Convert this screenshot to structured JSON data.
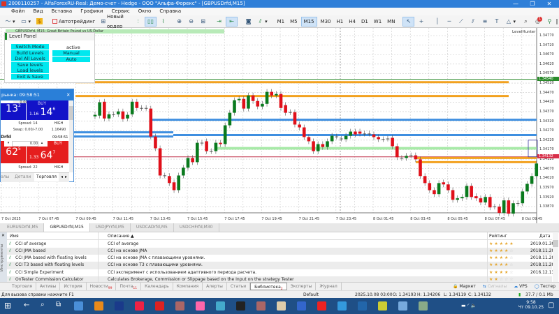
{
  "window": {
    "title": "2000110257 - AlfaForexRU-Real: Демо-счет - Hedge - ООО \"Альфа-Форекс\" - [GBPUSDrfd,M15]",
    "minimize": "—",
    "maximize": "❐",
    "close": "✕"
  },
  "menu": [
    "Файл",
    "Вид",
    "Вставка",
    "Графики",
    "Сервис",
    "Окно",
    "Справка"
  ],
  "toolbar": {
    "algo_trading": "Автотрейдинг",
    "new_order": "Новый ордер",
    "timeframes": [
      "M1",
      "M5",
      "M15",
      "M30",
      "H1",
      "H4",
      "D1",
      "W1",
      "MN"
    ],
    "active_timeframe": "M15",
    "notification_count": "1"
  },
  "chart": {
    "header": "GBPUSDrfd, M15:  Great Britain Pound vs US Dollar",
    "indicator_name": "LevelHunter",
    "colors": {
      "bull": "#0a7a1e",
      "bear": "#e0101a",
      "orange": "#f2a11e",
      "blue": "#3f8fe0",
      "green_band": "#9ee89e",
      "red_line": "#c0304a"
    }
  },
  "chart_data": {
    "type": "candlestick",
    "ylim": [
      1.3383,
      1.348
    ],
    "price_ticks": [
      "1.34770",
      "1.34720",
      "1.34670",
      "1.34620",
      "1.34570",
      "1.34520",
      "1.34470",
      "1.34420",
      "1.34370",
      "1.34320",
      "1.34270",
      "1.34220",
      "1.34170",
      "1.34120",
      "1.34070",
      "1.34020",
      "1.33970",
      "1.33920",
      "1.33870"
    ],
    "time_ticks": [
      "7 Oct 2025",
      "7 Oct 07:45",
      "7 Oct 09:45",
      "7 Oct 11:45",
      "7 Oct 13:45",
      "7 Oct 15:45",
      "7 Oct 17:45",
      "7 Oct 19:45",
      "7 Oct 21:45",
      "7 Oct 23:45",
      "8 Oct 01:45",
      "8 Oct 03:45",
      "8 Oct 05:45",
      "8 Oct 07:45",
      "8 Oct 09:45"
    ],
    "candles_open_close": [
      [
        1.34345,
        1.34353
      ],
      [
        1.34349,
        1.34419
      ],
      [
        1.34422,
        1.34334
      ],
      [
        1.34334,
        1.34356
      ],
      [
        1.34356,
        1.34356
      ],
      [
        1.34356,
        1.34371
      ],
      [
        1.34371,
        1.34331
      ],
      [
        1.34334,
        1.34353
      ],
      [
        1.34356,
        1.34422
      ],
      [
        1.34422,
        1.34389
      ],
      [
        1.34389,
        1.34389
      ],
      [
        1.34389,
        1.34389
      ],
      [
        1.34386,
        1.34239
      ],
      [
        1.34239,
        1.34177
      ],
      [
        1.34177,
        1.34034
      ],
      [
        1.34034,
        1.34034
      ],
      [
        1.34031,
        1.33994
      ],
      [
        1.33998,
        1.33957
      ],
      [
        1.33957,
        1.34034
      ],
      [
        1.34034,
        1.34075
      ],
      [
        1.34075,
        1.34126
      ],
      [
        1.34126,
        1.34104
      ],
      [
        1.34104,
        1.34206
      ],
      [
        1.34206,
        1.34206
      ],
      [
        1.34214,
        1.34162
      ],
      [
        1.34162,
        1.34162
      ],
      [
        1.34162,
        1.34206
      ],
      [
        1.34206,
        1.34199
      ],
      [
        1.34199,
        1.34298
      ],
      [
        1.34298,
        1.34364
      ],
      [
        1.34364,
        1.3443
      ],
      [
        1.3443,
        1.34437
      ],
      [
        1.34437,
        1.34386
      ],
      [
        1.34386,
        1.34455
      ],
      [
        1.34455,
        1.34426
      ],
      [
        1.34426,
        1.34397
      ],
      [
        1.34397,
        1.34411
      ],
      [
        1.34411,
        1.34474
      ],
      [
        1.34474,
        1.34455
      ],
      [
        1.34455,
        1.34463
      ],
      [
        1.34463,
        1.34389
      ],
      [
        1.34404,
        1.34364
      ],
      [
        1.34367,
        1.34367
      ],
      [
        1.34367,
        1.34302
      ],
      [
        1.34302,
        1.34287
      ],
      [
        1.34287,
        1.34236
      ],
      [
        1.34236,
        1.34214
      ],
      [
        1.34214,
        1.34162
      ],
      [
        1.34162,
        1.34199
      ],
      [
        1.34199,
        1.34184
      ],
      [
        1.34184,
        1.34214
      ],
      [
        1.34214,
        1.34243
      ],
      [
        1.34239,
        1.34239
      ],
      [
        1.34228,
        1.34228
      ],
      [
        1.34225,
        1.34243
      ],
      [
        1.34243,
        1.34265
      ],
      [
        1.34265,
        1.3425
      ],
      [
        1.34265,
        1.34254
      ],
      [
        1.34254,
        1.34254
      ],
      [
        1.34254,
        1.34254
      ],
      [
        1.3425,
        1.34236
      ],
      [
        1.34236,
        1.34225
      ],
      [
        1.34225,
        1.34225
      ],
      [
        1.34228,
        1.34228
      ],
      [
        1.34232,
        1.34188
      ],
      [
        1.34188,
        1.3413
      ],
      [
        1.34126,
        1.34126
      ],
      [
        1.34126,
        1.34137
      ],
      [
        1.3414,
        1.3414
      ],
      [
        1.3414,
        1.34119
      ],
      [
        1.34119,
        1.34031
      ],
      [
        1.34031,
        1.33994
      ],
      [
        1.33994,
        1.33957
      ],
      [
        1.33957,
        1.33936
      ],
      [
        1.33936,
        1.33994
      ],
      [
        1.33998,
        1.33987
      ],
      [
        1.33987,
        1.33957
      ],
      [
        1.33957,
        1.33906
      ],
      [
        1.33906,
        1.33914
      ],
      [
        1.33914,
        1.33921
      ],
      [
        1.33921,
        1.33979
      ],
      [
        1.33979,
        1.33921
      ],
      [
        1.33925,
        1.33914
      ],
      [
        1.33914,
        1.33892
      ],
      [
        1.33892,
        1.33921
      ],
      [
        1.33921,
        1.33866
      ],
      [
        1.3387,
        1.3387
      ],
      [
        1.3387,
        1.33837
      ],
      [
        1.33837,
        1.33903
      ],
      [
        1.33903,
        1.33833
      ],
      [
        1.33833,
        1.33888
      ],
      [
        1.33888,
        1.33888
      ],
      [
        1.33888,
        1.3395
      ],
      [
        1.3395,
        1.3399
      ],
      [
        1.3399,
        1.34031
      ],
      [
        1.34031,
        1.34097
      ]
    ],
    "levels": [
      {
        "price": 1.3454,
        "color": "green",
        "label": "1.34540"
      },
      {
        "price": 1.34525,
        "color": "orange"
      },
      {
        "price": 1.34452,
        "color": "orange"
      },
      {
        "price": 1.34327,
        "color": "blue"
      },
      {
        "price": 1.34261,
        "color": "blue"
      },
      {
        "price": 1.34247,
        "color": "blue"
      },
      {
        "price": 1.34239,
        "color": "blue"
      },
      {
        "price_from": 1.3417,
        "price_to": 1.34184,
        "color": "green_band"
      },
      {
        "price": 1.34132,
        "color": "red",
        "label": "1.34132"
      },
      {
        "price": 1.34126,
        "color": "orange"
      },
      {
        "price": 1.34104,
        "color": "orange"
      }
    ]
  },
  "level_panel": {
    "title": "Level Panel",
    "buttons": [
      "Switch Mode",
      "Build Levels",
      "Del All Levels",
      "Save levels",
      "Load levels",
      "Exit & Save"
    ],
    "mode_label": "active",
    "modes": [
      "Manual",
      "Auto"
    ]
  },
  "trade_panel": {
    "title": "рынка: 09:58:51",
    "sym1": {
      "lot": "0.00",
      "buy": "BUY",
      "sell_main": "13",
      "sell_sup": "2",
      "sell_prefix": "s",
      "buy_prefix": "1.16",
      "buy_main": "14",
      "buy_sup": "6",
      "spread": "Spread: 14",
      "swap": "Swap: 0.00/-7.00",
      "high_label": "HIGH",
      "high": "1.16490"
    },
    "sym2": {
      "name": "Drfd",
      "time": "09:58:51",
      "lot": "0.00",
      "buy": "BUY",
      "sell_main": "62",
      "sell_sup": "5",
      "sell_prefix": "s",
      "buy_prefix": "1.33",
      "buy_main": "64",
      "buy_sup": "7",
      "spread": "Spread: 22",
      "high_label": "HIGH"
    },
    "tabs": [
      "олы",
      "Детали",
      "Торговля"
    ]
  },
  "chart_tabs": [
    "EURUSDrfd,M5",
    "GBPUSDrfd,M15",
    "USDJPYrfd,M5",
    "USDCADrfd,M5",
    "USDCHFrfd,M30"
  ],
  "toolbox": {
    "side_label": "Инструменты",
    "columns": [
      "Имя",
      "Описание ▲",
      "Рейтинг",
      "Дата"
    ],
    "rows": [
      {
        "name": "CCI of average",
        "desc": "CCI of average",
        "rating": 4.5,
        "date": "2019.01.30"
      },
      {
        "name": "CCI JMA based",
        "desc": "CCI на основе JMA",
        "rating": 4,
        "date": "2018.11.28"
      },
      {
        "name": "CCI JMA based with floating levels",
        "desc": "CCI на основе JMA с плавающими уровнями.",
        "rating": 3.5,
        "date": "2018.11.28"
      },
      {
        "name": "CCI T3 based with floating levels",
        "desc": "CCI на основе T3 с плавающими уровнями.",
        "rating": 3.5,
        "date": "2018.11.28"
      },
      {
        "name": "CCI Simple Experiment",
        "desc": "CCI эксперимент с использованием адаптивного периода расчета.",
        "rating": 4,
        "date": "2016.12.13"
      },
      {
        "name": "OnTester Commission Calculator",
        "desc": "Calculates Brokerage, Commission or Slippage based on the Input on the strategy Tester",
        "rating": 2,
        "date": ""
      }
    ],
    "tabs": [
      {
        "label": "Торговля"
      },
      {
        "label": "Активы"
      },
      {
        "label": "История"
      },
      {
        "label": "Новости",
        "badge": "99"
      },
      {
        "label": "Почта",
        "badge": "11"
      },
      {
        "label": "Календарь"
      },
      {
        "label": "Компания"
      },
      {
        "label": "Алерты"
      },
      {
        "label": "Статьи"
      },
      {
        "label": "Библиотека",
        "badge": "2",
        "active": true
      },
      {
        "label": "Эксперты"
      },
      {
        "label": "Журнал"
      }
    ],
    "right_links": [
      "Маркет",
      "Сигналы",
      "VPS",
      "Тестер"
    ]
  },
  "status": {
    "help": "Для вызова справки нажмите F1",
    "profile": "Default",
    "datetime": "2025.10.08 03:00",
    "open": "O: 1.34193",
    "high": "H: 1.34206",
    "low": "L: 1.34119",
    "close": "C: 1.34132",
    "traffic": "37.7 / 0.1 Mb"
  },
  "taskbar": {
    "time": "9:58",
    "date": "Чт 09.10.25"
  }
}
